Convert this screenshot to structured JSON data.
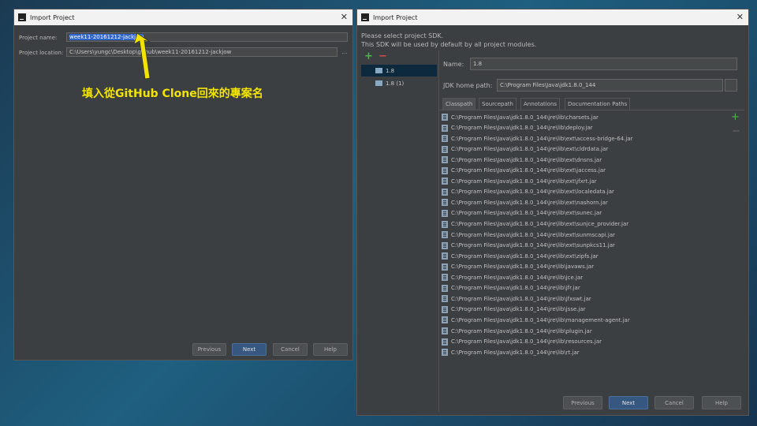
{
  "left_dialog": {
    "title": "Import Project",
    "project_name_label": "Project name:",
    "project_name_value": "week11-20161212-jackjow",
    "project_location_label": "Project location:",
    "project_location_value": "C:\\Users\\yungc\\Desktop\\github\\week11-20161212-jackjow",
    "browse_label": "...",
    "buttons": {
      "previous": "Previous",
      "next": "Next",
      "cancel": "Cancel",
      "help": "Help"
    }
  },
  "annotation": {
    "text": "填入從GitHub Clone回來的專案名",
    "color": "#f2e400"
  },
  "right_dialog": {
    "title": "Import Project",
    "instruction_line1": "Please select project SDK.",
    "instruction_line2": "This SDK will be used by default by all project modules.",
    "add_label": "+",
    "remove_label": "−",
    "sdk_list": [
      "1.8",
      "1.8 (1)"
    ],
    "selected_sdk": "1.8",
    "name_label": "Name:",
    "name_value": "1.8",
    "jdk_home_label": "JDK home path:",
    "jdk_home_value": "C:\\Program Files\\Java\\jdk1.8.0_144",
    "tabs": [
      "Classpath",
      "Sourcepath",
      "Annotations",
      "Documentation Paths"
    ],
    "active_tab": "Classpath",
    "side_add": "+",
    "side_remove": "−",
    "classpath": [
      "C:\\Program Files\\Java\\jdk1.8.0_144\\jre\\lib\\charsets.jar",
      "C:\\Program Files\\Java\\jdk1.8.0_144\\jre\\lib\\deploy.jar",
      "C:\\Program Files\\Java\\jdk1.8.0_144\\jre\\lib\\ext\\access-bridge-64.jar",
      "C:\\Program Files\\Java\\jdk1.8.0_144\\jre\\lib\\ext\\cldrdata.jar",
      "C:\\Program Files\\Java\\jdk1.8.0_144\\jre\\lib\\ext\\dnsns.jar",
      "C:\\Program Files\\Java\\jdk1.8.0_144\\jre\\lib\\ext\\jaccess.jar",
      "C:\\Program Files\\Java\\jdk1.8.0_144\\jre\\lib\\ext\\jfxrt.jar",
      "C:\\Program Files\\Java\\jdk1.8.0_144\\jre\\lib\\ext\\localedata.jar",
      "C:\\Program Files\\Java\\jdk1.8.0_144\\jre\\lib\\ext\\nashorn.jar",
      "C:\\Program Files\\Java\\jdk1.8.0_144\\jre\\lib\\ext\\sunec.jar",
      "C:\\Program Files\\Java\\jdk1.8.0_144\\jre\\lib\\ext\\sunjce_provider.jar",
      "C:\\Program Files\\Java\\jdk1.8.0_144\\jre\\lib\\ext\\sunmscapi.jar",
      "C:\\Program Files\\Java\\jdk1.8.0_144\\jre\\lib\\ext\\sunpkcs11.jar",
      "C:\\Program Files\\Java\\jdk1.8.0_144\\jre\\lib\\ext\\zipfs.jar",
      "C:\\Program Files\\Java\\jdk1.8.0_144\\jre\\lib\\javaws.jar",
      "C:\\Program Files\\Java\\jdk1.8.0_144\\jre\\lib\\jce.jar",
      "C:\\Program Files\\Java\\jdk1.8.0_144\\jre\\lib\\jfr.jar",
      "C:\\Program Files\\Java\\jdk1.8.0_144\\jre\\lib\\jfxswt.jar",
      "C:\\Program Files\\Java\\jdk1.8.0_144\\jre\\lib\\jsse.jar",
      "C:\\Program Files\\Java\\jdk1.8.0_144\\jre\\lib\\management-agent.jar",
      "C:\\Program Files\\Java\\jdk1.8.0_144\\jre\\lib\\plugin.jar",
      "C:\\Program Files\\Java\\jdk1.8.0_144\\jre\\lib\\resources.jar",
      "C:\\Program Files\\Java\\jdk1.8.0_144\\jre\\lib\\rt.jar"
    ],
    "buttons": {
      "previous": "Previous",
      "next": "Next",
      "cancel": "Cancel",
      "help": "Help"
    }
  }
}
